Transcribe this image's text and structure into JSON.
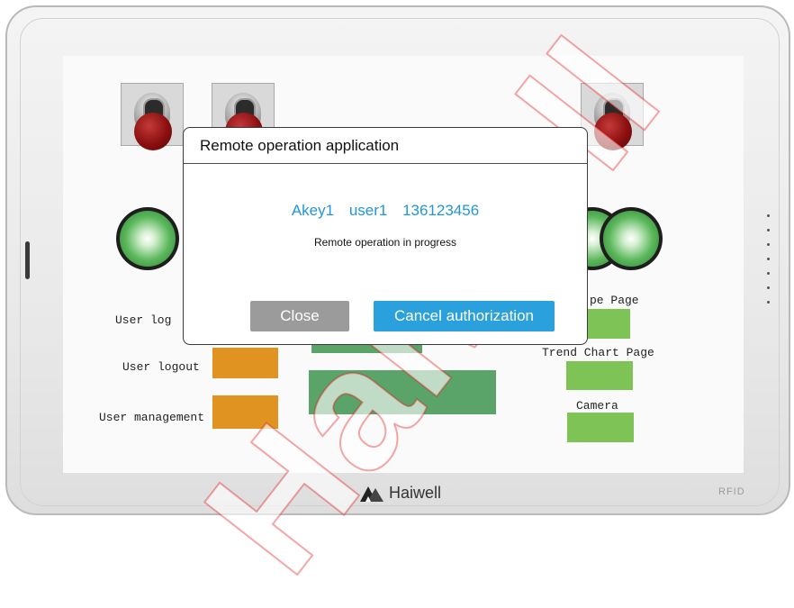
{
  "hmi": {
    "labels": {
      "user_login": "User log",
      "user_logout": "User logout",
      "user_management": "User management",
      "type_page": "pe Page",
      "trend_chart_page": "Trend Chart Page",
      "camera": "Camera"
    },
    "colors": {
      "orange_button": "#e09320",
      "green_button": "#7dc356",
      "dark_green_bar": "#5aa46a"
    }
  },
  "dialog": {
    "title": "Remote operation application",
    "account": "Akey1",
    "user": "user1",
    "phone": "136123456",
    "status": "Remote operation in progress",
    "close_label": "Close",
    "cancel_label": "Cancel authorization",
    "accent_color": "#2aa0dc"
  },
  "device": {
    "brand": "Haiwell",
    "badge": "RFID"
  },
  "watermark": "Haiwell"
}
